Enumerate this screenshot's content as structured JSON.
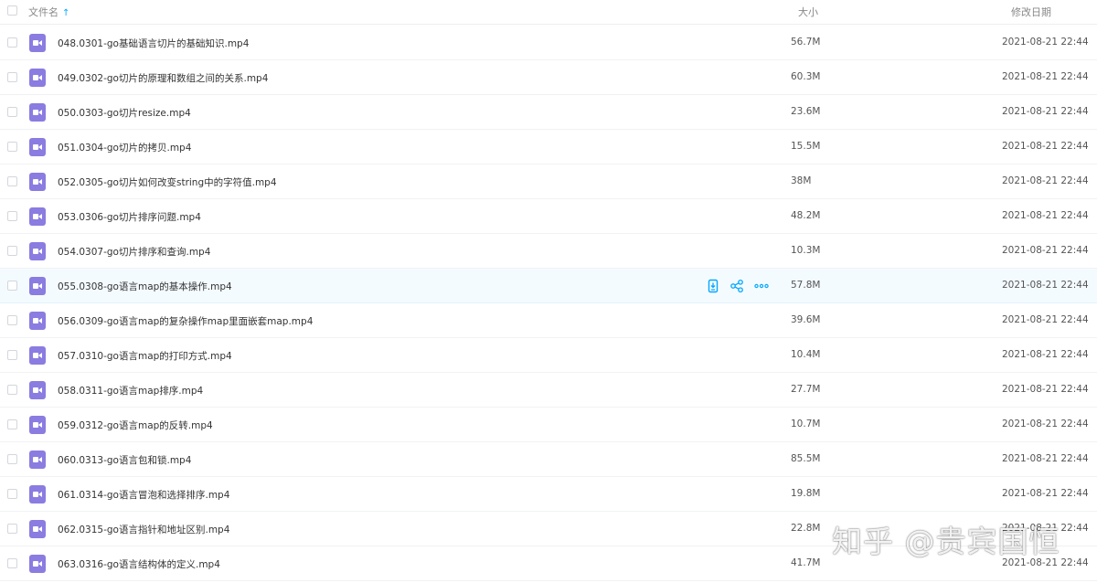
{
  "header": {
    "col_name": "文件名",
    "sort_indicator": "arrow-up-icon",
    "col_size": "大小",
    "col_date": "修改日期"
  },
  "files": [
    {
      "name": "048.0301-go基础语言切片的基础知识.mp4",
      "size": "56.7M",
      "date": "2021-08-21 22:44"
    },
    {
      "name": "049.0302-go切片的原理和数组之间的关系.mp4",
      "size": "60.3M",
      "date": "2021-08-21 22:44"
    },
    {
      "name": "050.0303-go切片resize.mp4",
      "size": "23.6M",
      "date": "2021-08-21 22:44"
    },
    {
      "name": "051.0304-go切片的拷贝.mp4",
      "size": "15.5M",
      "date": "2021-08-21 22:44"
    },
    {
      "name": "052.0305-go切片如何改变string中的字符值.mp4",
      "size": "38M",
      "date": "2021-08-21 22:44"
    },
    {
      "name": "053.0306-go切片排序问题.mp4",
      "size": "48.2M",
      "date": "2021-08-21 22:44"
    },
    {
      "name": "054.0307-go切片排序和查询.mp4",
      "size": "10.3M",
      "date": "2021-08-21 22:44"
    },
    {
      "name": "055.0308-go语言map的基本操作.mp4",
      "size": "57.8M",
      "date": "2021-08-21 22:44"
    },
    {
      "name": "056.0309-go语言map的复杂操作map里面嵌套map.mp4",
      "size": "39.6M",
      "date": "2021-08-21 22:44"
    },
    {
      "name": "057.0310-go语言map的打印方式.mp4",
      "size": "10.4M",
      "date": "2021-08-21 22:44"
    },
    {
      "name": "058.0311-go语言map排序.mp4",
      "size": "27.7M",
      "date": "2021-08-21 22:44"
    },
    {
      "name": "059.0312-go语言map的反转.mp4",
      "size": "10.7M",
      "date": "2021-08-21 22:44"
    },
    {
      "name": "060.0313-go语言包和锁.mp4",
      "size": "85.5M",
      "date": "2021-08-21 22:44"
    },
    {
      "name": "061.0314-go语言冒泡和选择排序.mp4",
      "size": "19.8M",
      "date": "2021-08-21 22:44"
    },
    {
      "name": "062.0315-go语言指针和地址区别.mp4",
      "size": "22.8M",
      "date": "2021-08-21 22:44"
    },
    {
      "name": "063.0316-go语言结构体的定义.mp4",
      "size": "41.7M",
      "date": "2021-08-21 22:44"
    }
  ],
  "hover_row_actions": {
    "download": "download-icon",
    "share": "share-icon",
    "more": "more-icon"
  },
  "watermark": "知乎 @贵宾国恒",
  "colors": {
    "accent": "#06a7ff",
    "video_icon": "#8a7ce0",
    "hover_row": "#f4fbff"
  }
}
